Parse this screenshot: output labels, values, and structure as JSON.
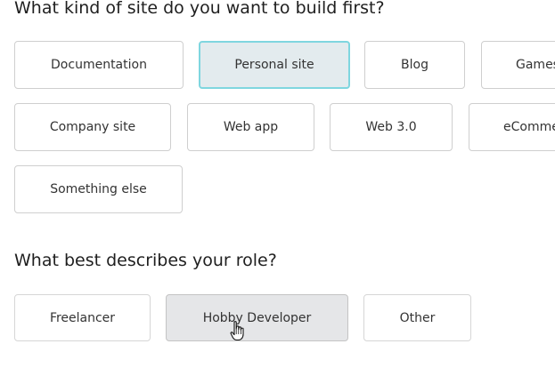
{
  "site_question": {
    "title": "What kind of site do you want to build first?",
    "options": [
      "Documentation",
      "Personal site",
      "Blog",
      "Games",
      "Company site",
      "Web app",
      "Web 3.0",
      "eCommerce",
      "Something else"
    ],
    "selected": "Personal site"
  },
  "role_question": {
    "title": "What best describes your role?",
    "options": [
      "Freelancer",
      "Hobby Developer",
      "Other"
    ],
    "hovered": "Hobby Developer"
  },
  "icons": {
    "cursor": "hand-pointer-icon"
  }
}
